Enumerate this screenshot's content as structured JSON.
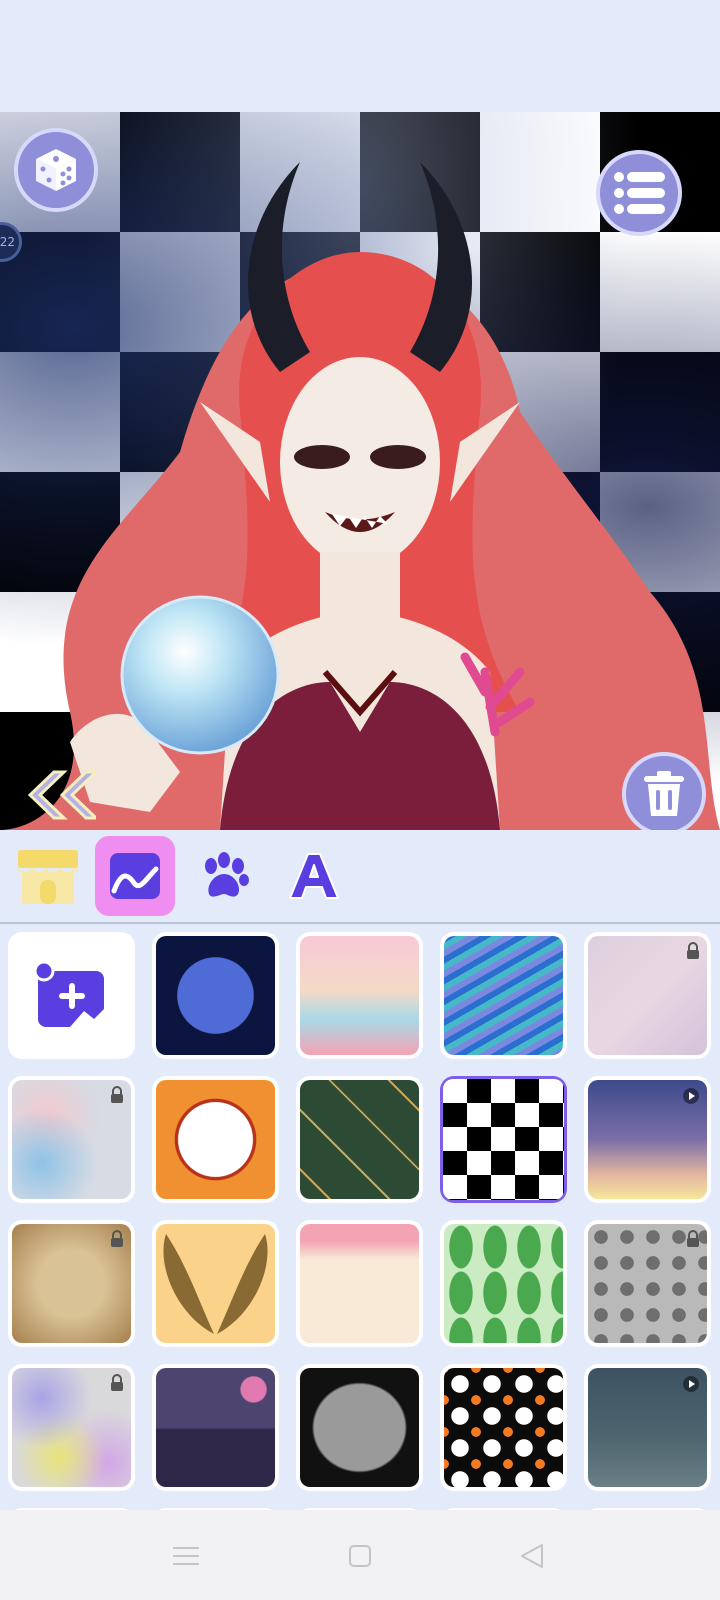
{
  "canvas": {
    "badge_number": "22"
  },
  "buttons": {
    "random": "dice-icon",
    "menu": "list-icon",
    "delete": "trash-icon",
    "collapse": "double-chevron-left-icon"
  },
  "tabs": [
    {
      "name": "shop",
      "icon": "shop-icon",
      "active": false
    },
    {
      "name": "background",
      "icon": "landscape-icon",
      "active": true
    },
    {
      "name": "pets",
      "icon": "paw-icon",
      "active": false
    },
    {
      "name": "text",
      "icon": "letter-a-icon",
      "active": false
    }
  ],
  "backgrounds": [
    {
      "id": "upload",
      "kind": "upload-image",
      "locked": false,
      "video": false
    },
    {
      "id": "galaxy",
      "locked": false,
      "video": false
    },
    {
      "id": "pastel-clouds",
      "locked": false,
      "video": false
    },
    {
      "id": "blue-waves",
      "locked": false,
      "video": false
    },
    {
      "id": "pink-marble",
      "locked": true,
      "video": false
    },
    {
      "id": "watercolor",
      "locked": true,
      "video": false
    },
    {
      "id": "orange-frame",
      "locked": false,
      "video": false
    },
    {
      "id": "green-pattern",
      "locked": false,
      "video": false
    },
    {
      "id": "checkerboard",
      "locked": false,
      "video": false,
      "selected": true
    },
    {
      "id": "sunset-sky",
      "locked": false,
      "video": true
    },
    {
      "id": "parchment",
      "locked": true,
      "video": false
    },
    {
      "id": "golden-wings",
      "locked": false,
      "video": false
    },
    {
      "id": "floral-bows",
      "locked": false,
      "video": false
    },
    {
      "id": "green-leaves",
      "locked": false,
      "video": false
    },
    {
      "id": "skull-pattern",
      "locked": true,
      "video": false
    },
    {
      "id": "paint-splash",
      "locked": true,
      "video": false
    },
    {
      "id": "purple-mountains",
      "locked": false,
      "video": false
    },
    {
      "id": "halloween-frame",
      "locked": false,
      "video": false
    },
    {
      "id": "ghost-pattern",
      "locked": false,
      "video": false
    },
    {
      "id": "night-clouds",
      "locked": false,
      "video": true
    }
  ],
  "navigation": {
    "recent": "menu-icon",
    "home": "square-icon",
    "back": "triangle-back-icon"
  }
}
